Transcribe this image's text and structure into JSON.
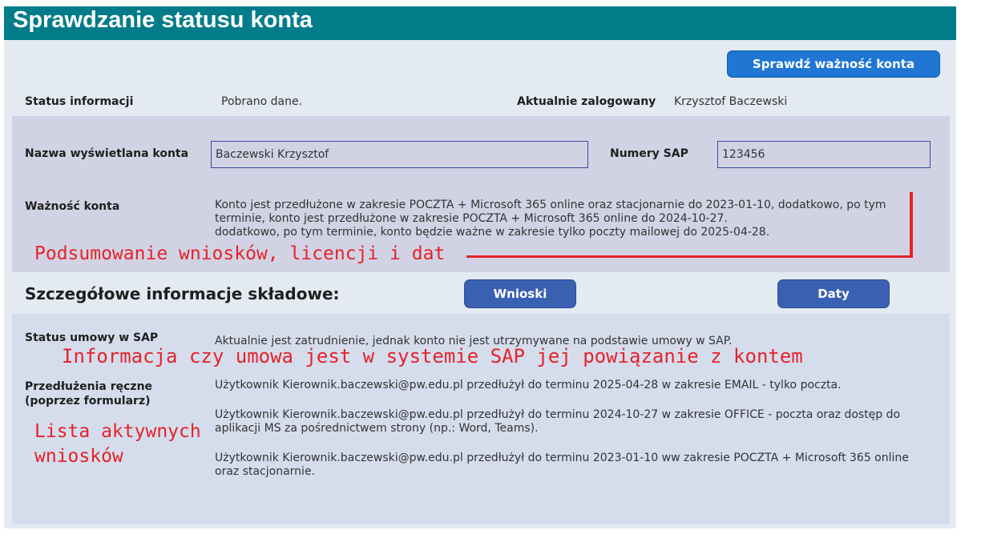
{
  "title": "Sprawdzanie statusu konta",
  "check_button": "Sprawdź ważność konta",
  "status": {
    "label": "Status informacji",
    "value": "Pobrano dane."
  },
  "current_user": {
    "label": "Aktualnie zalogowany",
    "value": "Krzysztof Baczewski"
  },
  "account_name": {
    "label": "Nazwa wyświetlana konta",
    "value": "Baczewski Krzysztof"
  },
  "sap_numbers": {
    "label": "Numery SAP",
    "value": "123456"
  },
  "validity": {
    "label": "Ważność konta",
    "lines": [
      "Konto jest przedłużone w zakresie POCZTA + Microsoft 365 online oraz stacjonarnie do 2023-01-10, dodatkowo, po tym",
      "terminie, konto jest przedłużone w zakresie POCZTA + Microsoft 365 online do 2024-10-27.",
      "dodatkowo, po tym terminie, konto będzie ważne w zakresie tylko poczty mailowej do 2025-04-28."
    ]
  },
  "details": {
    "heading": "Szczegółowe informacje składowe:",
    "button_requests": "Wnioski",
    "button_dates": "Daty"
  },
  "sap_contract": {
    "label": "Status umowy w SAP",
    "value": "Aktualnie jest zatrudnienie, jednak konto nie jest utrzymywane na podstawie umowy w SAP."
  },
  "manual_extensions": {
    "label_line1": "Przedłużenia ręczne",
    "label_line2": "(poprzez formularz)",
    "entries": [
      {
        "lines": [
          "Użytkownik Kierownik.baczewski@pw.edu.pl przedłużył do terminu 2025-04-28 w zakresie EMAIL - tylko poczta."
        ]
      },
      {
        "lines": [
          "Użytkownik Kierownik.baczewski@pw.edu.pl przedłużył do terminu 2024-10-27 w zakresie OFFICE - poczta oraz dostęp do",
          "aplikacji MS za pośrednictwem strony (np.: Word, Teams)."
        ]
      },
      {
        "lines": [
          "Użytkownik Kierownik.baczewski@pw.edu.pl przedłużył do terminu 2023-01-10 ww zakresie POCZTA + Microsoft 365 online",
          "oraz stacjonarnie."
        ]
      }
    ]
  },
  "annotations": {
    "summary": "Podsumowanie wniosków, licencji i dat",
    "contract": "Informacja czy umowa jest w systemie SAP jej powiązanie z kontem",
    "list_line1": "Lista aktywnych",
    "list_line2": "wniosków"
  },
  "colors": {
    "header": "#037c8a",
    "button": "#1f76d3",
    "button_dark": "#3a60b2",
    "annotation": "#e6222a"
  }
}
